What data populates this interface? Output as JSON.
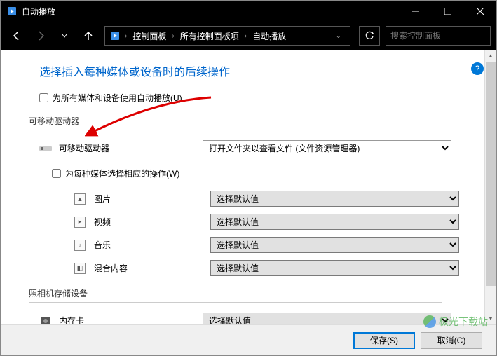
{
  "window": {
    "title": "自动播放"
  },
  "breadcrumb": {
    "items": [
      "控制面板",
      "所有控制面板项",
      "自动播放"
    ]
  },
  "search": {
    "placeholder": "搜索控制面板"
  },
  "content": {
    "heading": "选择插入每种媒体或设备时的后续操作",
    "use_autoplay_label": "为所有媒体和设备使用自动播放(U)",
    "removable_section": "可移动驱动器",
    "removable_drive_label": "可移动驱动器",
    "removable_drive_value": "打开文件夹以查看文件 (文件资源管理器)",
    "choose_each_label": "为每种媒体选择相应的操作(W)",
    "media": {
      "pictures": {
        "label": "图片",
        "value": "选择默认值"
      },
      "videos": {
        "label": "视频",
        "value": "选择默认值"
      },
      "music": {
        "label": "音乐",
        "value": "选择默认值"
      },
      "mixed": {
        "label": "混合内容",
        "value": "选择默认值"
      }
    },
    "camera_section": "照相机存储设备",
    "memory_card_label": "内存卡",
    "memory_card_value": "选择默认值"
  },
  "footer": {
    "save": "保存(S)",
    "cancel": "取消(C)"
  },
  "watermark": "极光下载站"
}
